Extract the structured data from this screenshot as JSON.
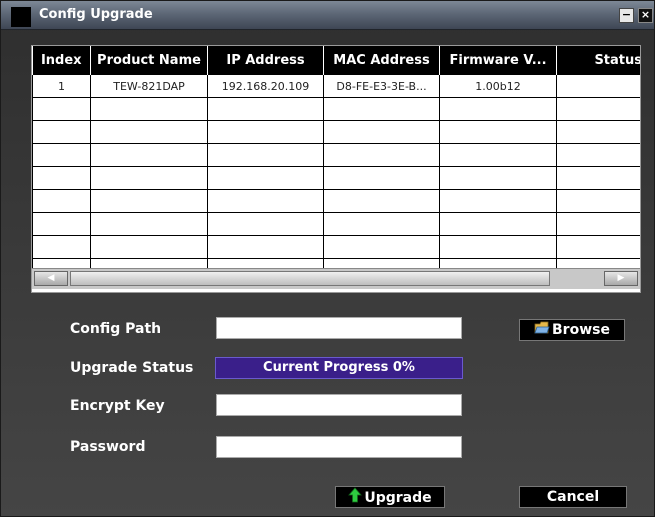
{
  "window": {
    "title": "Config Upgrade",
    "minimize_glyph": "−",
    "close_glyph": "×"
  },
  "table": {
    "columns": [
      "Index",
      "Product Name",
      "IP Address",
      "MAC Address",
      "Firmware V...",
      "Status"
    ],
    "rows": [
      [
        "1",
        "TEW-821DAP",
        "192.168.20.109",
        "D8-FE-E3-3E-B...",
        "1.00b12",
        ""
      ]
    ],
    "empty_row_count": 8
  },
  "scrollbar": {
    "left_glyph": "◀",
    "right_glyph": "▶"
  },
  "form": {
    "config_path_label": "Config Path",
    "config_path_value": "",
    "upgrade_status_label": "Upgrade Status",
    "progress_text": "Current Progress 0%",
    "progress_fraction": 0,
    "encrypt_key_label": "Encrypt Key",
    "encrypt_key_value": "",
    "password_label": "Password",
    "password_value": ""
  },
  "buttons": {
    "browse_label": "Browse",
    "upgrade_label": "Upgrade",
    "cancel_label": "Cancel"
  },
  "icons": {
    "browse": "folder-icon",
    "upgrade": "up-arrow-icon"
  },
  "colors": {
    "progress_bg": "#3a1f8a",
    "upgrade_arrow": "#2ecc40"
  }
}
